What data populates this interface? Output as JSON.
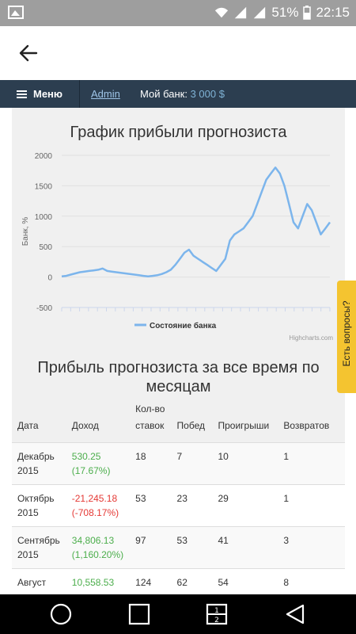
{
  "status": {
    "battery": "51%",
    "time": "22:15"
  },
  "navbar": {
    "menu": "Меню",
    "admin": "Admin",
    "bank_label": "Мой банк:",
    "bank_value": "3 000 $"
  },
  "chart_title": "График прибыли прогнозиста",
  "chart_data": {
    "type": "line",
    "title": "График прибыли прогнозиста",
    "ylabel": "Банк, %",
    "ylim": [
      -500,
      2000
    ],
    "yticks": [
      "2000",
      "1500",
      "1000",
      "500",
      "0",
      "-500"
    ],
    "grid": true,
    "legend": "bottom",
    "series": [
      {
        "name": "Состояние банка",
        "color": "#7cb5ec",
        "values": [
          10,
          20,
          40,
          60,
          80,
          90,
          100,
          110,
          120,
          140,
          100,
          90,
          80,
          70,
          60,
          50,
          40,
          30,
          20,
          10,
          20,
          30,
          50,
          80,
          120,
          200,
          300,
          400,
          450,
          350,
          300,
          250,
          200,
          150,
          100,
          200,
          300,
          600,
          700,
          750,
          800,
          900,
          1000,
          1200,
          1400,
          1600,
          1700,
          1800,
          1700,
          1500,
          1200,
          900,
          800,
          1000,
          1200,
          1100,
          900,
          700,
          800,
          900
        ]
      }
    ],
    "credits": "Highcharts.com"
  },
  "section_title": "Прибыль прогнозиста за все время по месяцам",
  "table": {
    "headers": [
      "Дата",
      "Доход",
      "Кол-во ставок",
      "Побед",
      "Проигрыши",
      "Возвратов"
    ],
    "rows": [
      {
        "date": "Декабрь 2015",
        "income": "530.25",
        "pct": "(17.67%)",
        "sign": "pos",
        "bets": "18",
        "wins": "7",
        "losses": "10",
        "returns": "1"
      },
      {
        "date": "Октябрь 2015",
        "income": "-21,245.18",
        "pct": "(-708.17%)",
        "sign": "neg",
        "bets": "53",
        "wins": "23",
        "losses": "29",
        "returns": "1"
      },
      {
        "date": "Сентябрь 2015",
        "income": "34,806.13",
        "pct": "(1,160.20%)",
        "sign": "pos",
        "bets": "97",
        "wins": "53",
        "losses": "41",
        "returns": "3"
      },
      {
        "date": "Август",
        "income": "10,558.53",
        "pct": "",
        "sign": "pos",
        "bets": "124",
        "wins": "62",
        "losses": "54",
        "returns": "8"
      }
    ]
  },
  "ask_button": "Есть вопросы?"
}
